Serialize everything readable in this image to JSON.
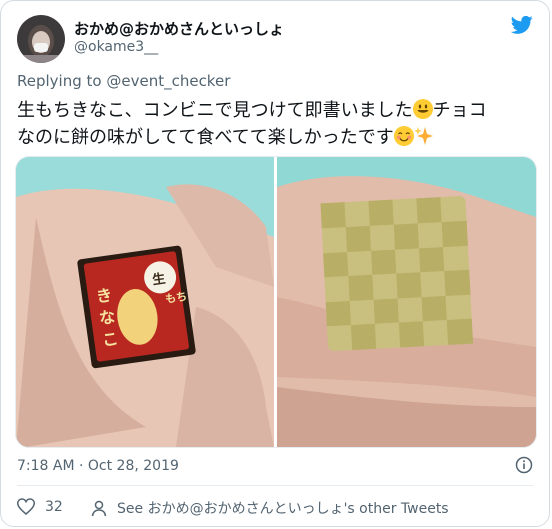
{
  "author": {
    "display_name": "おかめ@おかめさんといっしょ",
    "handle": "@okame3__"
  },
  "reply": {
    "prefix": "Replying to",
    "mention": "@event_checker"
  },
  "tweet": {
    "line1": "生もちきなこ、コンビニで見つけて即書いました",
    "line1_tail": "チョコ",
    "line2": "なのに餅の味がしてて食べてて楽しかったです"
  },
  "footer": {
    "time": "7:18 AM · Oct 28, 2019",
    "likes": "32",
    "other_tweets": "See おかめ@おかめさんといっしょ's other Tweets"
  },
  "icons": {
    "brand": "twitter-bird-icon",
    "info": "info-icon",
    "like": "heart-icon",
    "profile": "person-icon"
  },
  "colors": {
    "brand": "#1d9bf0",
    "muted": "#536471"
  },
  "photos": {
    "left_label_kanji": "きなこ",
    "left_badge": "生もち"
  }
}
